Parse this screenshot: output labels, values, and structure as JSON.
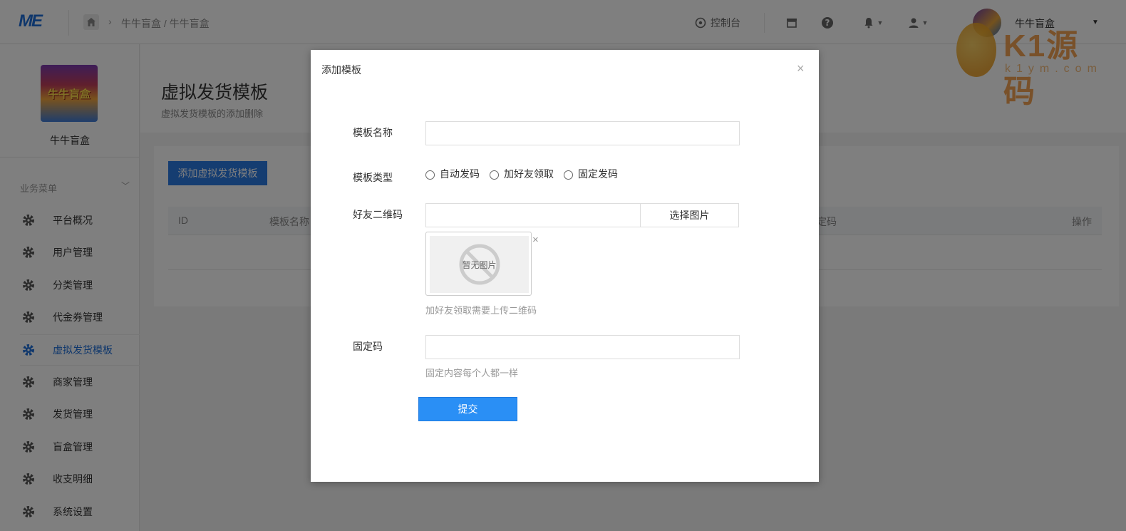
{
  "topbar": {
    "logo": "ME",
    "breadcrumb": "牛牛盲盒 / 牛牛盲盒",
    "console_label": "控制台",
    "user_name": "牛牛盲盒"
  },
  "watermark": {
    "text": "K1源码",
    "sub": "k1ym.com"
  },
  "sidebar": {
    "shop_logo_text": "牛牛盲盒",
    "shop_name": "牛牛盲盒",
    "menu_title": "业务菜单",
    "items": [
      {
        "label": "平台概况"
      },
      {
        "label": "用户管理"
      },
      {
        "label": "分类管理"
      },
      {
        "label": "代金券管理"
      },
      {
        "label": "虚拟发货模板",
        "active": true
      },
      {
        "label": "商家管理"
      },
      {
        "label": "发货管理"
      },
      {
        "label": "盲盒管理"
      },
      {
        "label": "收支明细"
      },
      {
        "label": "系统设置"
      }
    ]
  },
  "main": {
    "title": "虚拟发货模板",
    "subtitle": "虚拟发货模板的添加删除",
    "add_button": "添加虚拟发货模板",
    "columns": [
      "ID",
      "模板名称",
      "定码",
      "操作"
    ]
  },
  "modal": {
    "title": "添加模板",
    "close": "×",
    "name_label": "模板名称",
    "name_value": "",
    "type_label": "模板类型",
    "type_options": [
      "自动发码",
      "加好友领取",
      "固定发码"
    ],
    "qr_label": "好友二维码",
    "choose_image": "选择图片",
    "no_image": "暂无图片",
    "remove": "×",
    "qr_help": "加好友领取需要上传二维码",
    "fixed_label": "固定码",
    "fixed_value": "",
    "fixed_help": "固定内容每个人都一样",
    "submit": "提交"
  },
  "colors": {
    "primary": "#2a7ae2",
    "submit": "#2a8ff5",
    "active_menu": "#1e6fd9"
  }
}
